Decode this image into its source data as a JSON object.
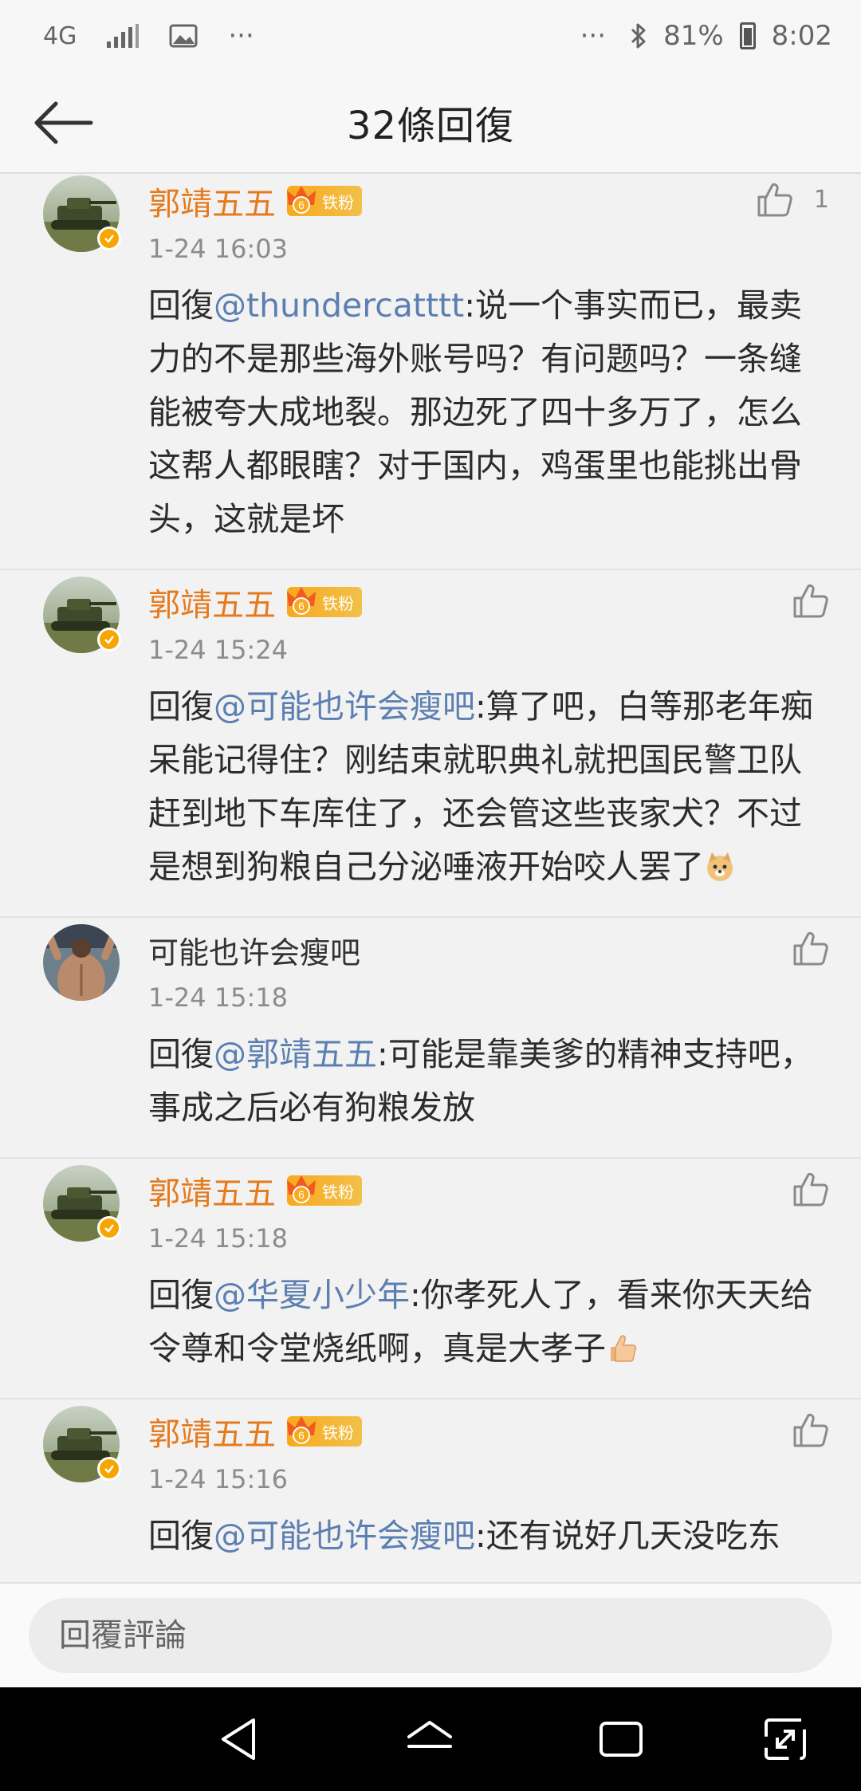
{
  "status_bar": {
    "network": "4G",
    "more_left": "···",
    "more_right": "···",
    "battery": "81%",
    "time": "8:02"
  },
  "header": {
    "title": "32條回復"
  },
  "replies": [
    {
      "name": "郭靖五五",
      "badge": "铁粉",
      "time": "1-24 16:03",
      "likes": "1",
      "prefix": "回復",
      "mention": "@thundercatttt",
      "text": ":说一个事实而已，最卖力的不是那些海外账号吗？有问题吗？一条缝能被夸大成地裂。那边死了四十多万了，怎么这帮人都眼瞎？对于国内，鸡蛋里也能挑出骨头，这就是坏"
    },
    {
      "name": "郭靖五五",
      "badge": "铁粉",
      "time": "1-24 15:24",
      "prefix": "回復",
      "mention": "@可能也许会瘦吧",
      "text": ":算了吧，白等那老年痴呆能记得住？刚结束就职典礼就把国民警卫队赶到地下车库住了，还会管这些丧家犬？不过是想到狗粮自己分泌唾液开始咬人罢了"
    },
    {
      "name": "可能也许会瘦吧",
      "time": "1-24 15:18",
      "prefix": "回復",
      "mention": "@郭靖五五",
      "text": ":可能是靠美爹的精神支持吧，事成之后必有狗粮发放"
    },
    {
      "name": "郭靖五五",
      "badge": "铁粉",
      "time": "1-24 15:18",
      "prefix": "回復",
      "mention": "@华夏小少年",
      "text": ":你孝死人了，看来你天天给令尊和令堂烧纸啊，真是大孝子"
    },
    {
      "name": "郭靖五五",
      "badge": "铁粉",
      "time": "1-24 15:16",
      "prefix": "回復",
      "mention": "@可能也许会瘦吧",
      "text": ":还有说好几天没吃东"
    }
  ],
  "input": {
    "placeholder": "回覆評論"
  },
  "colors": {
    "username": "#e57a1d",
    "mention": "#5b7fb1",
    "fan_badge": "#f8a91c"
  },
  "icons": {
    "back": "arrow-left-icon",
    "like": "thumbs-up-icon",
    "nav_back": "triangle-back-icon",
    "nav_home": "home-icon",
    "nav_recent": "recent-apps-icon",
    "nav_rotate": "rotate-icon"
  }
}
